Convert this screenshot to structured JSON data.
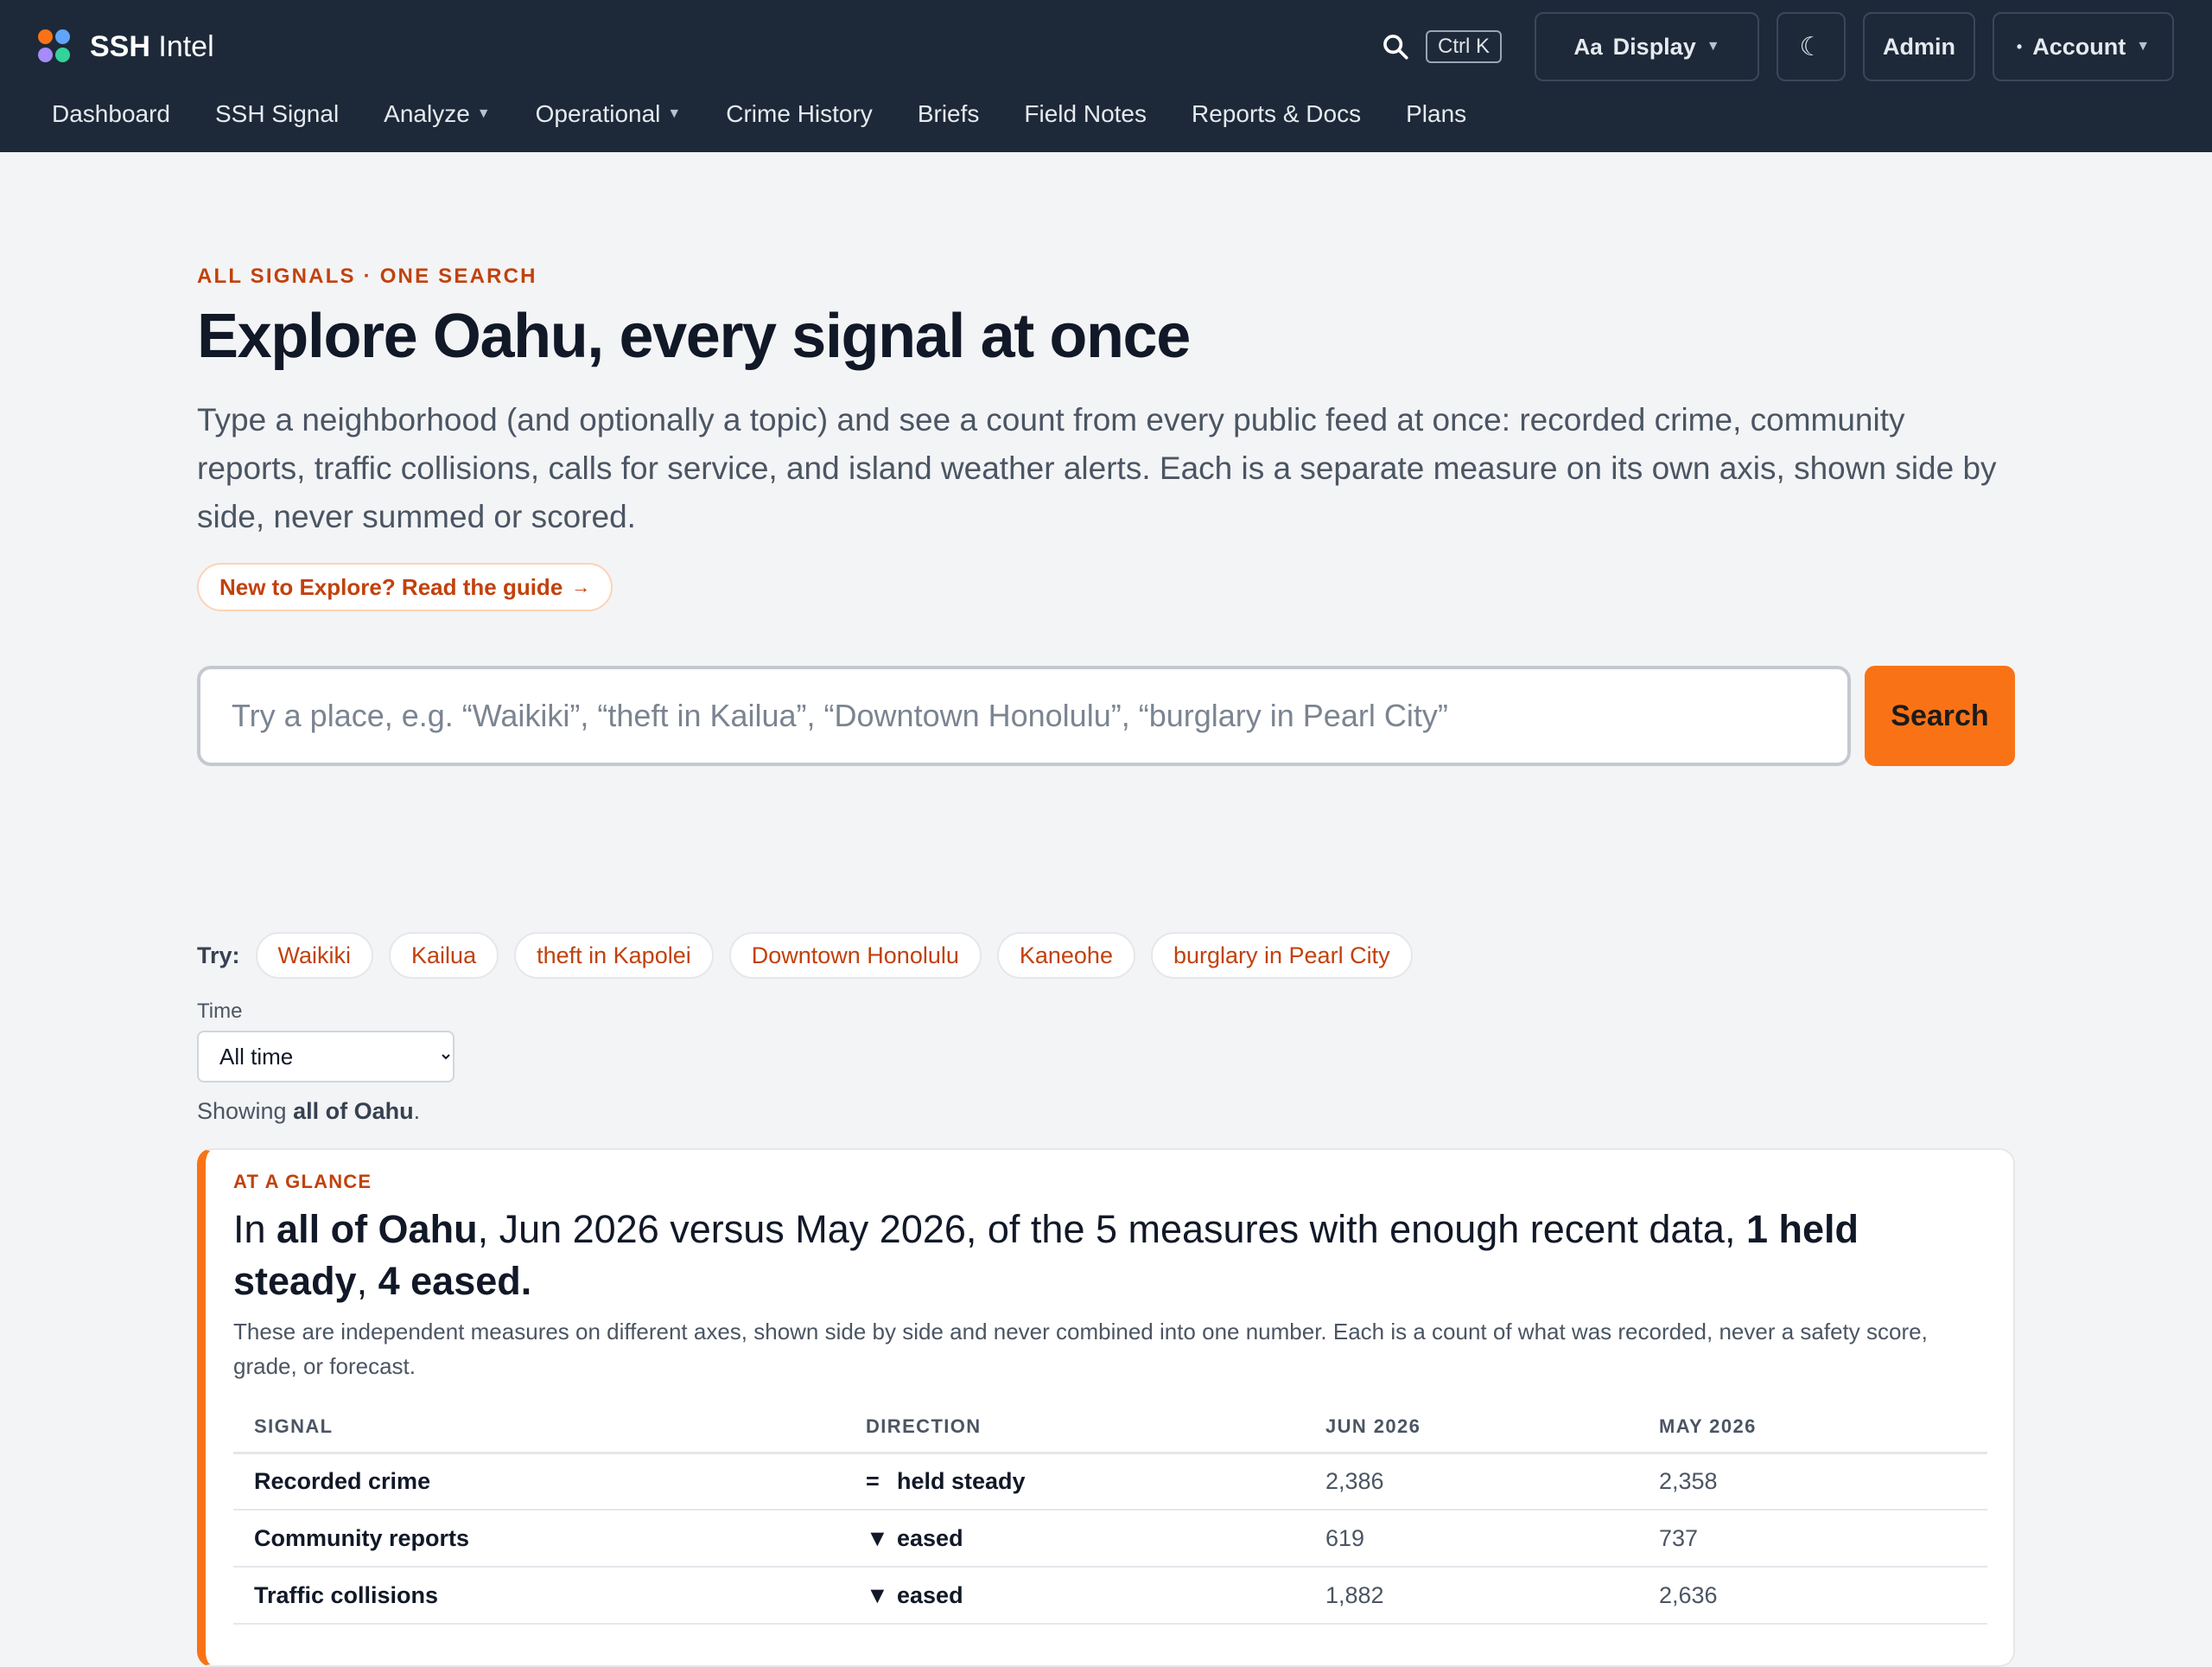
{
  "brand": {
    "name_bold": "SSH",
    "name_rest": "Intel"
  },
  "header": {
    "shortcut": "Ctrl K",
    "display_label": "Display",
    "display_icon_text": "Aa",
    "theme_icon": "moon-icon",
    "admin_label": "Admin",
    "account_label": "Account"
  },
  "nav": {
    "items": [
      {
        "label": "Dashboard"
      },
      {
        "label": "SSH Signal"
      },
      {
        "label": "Analyze",
        "dropdown": true
      },
      {
        "label": "Operational",
        "dropdown": true
      },
      {
        "label": "Crime History"
      },
      {
        "label": "Briefs"
      },
      {
        "label": "Field Notes"
      },
      {
        "label": "Reports & Docs"
      },
      {
        "label": "Plans"
      }
    ]
  },
  "hero": {
    "eyebrow": "ALL SIGNALS · ONE SEARCH",
    "title": "Explore Oahu, every signal at once",
    "lead": "Type a neighborhood (and optionally a topic) and see a count from every public feed at once: recorded crime, community reports, traffic collisions, calls for service, and island weather alerts. Each is a separate measure on its own axis, shown side by side, never summed or scored.",
    "guide_link": "New to Explore? Read the guide",
    "guide_arrow": "→"
  },
  "search": {
    "placeholder": "Try a place, e.g. “Waikiki”, “theft in Kailua”, “Downtown Honolulu”, “burglary in Pearl City”",
    "value": "",
    "button": "Search",
    "try_label": "Try:",
    "suggestions": [
      "Waikiki",
      "Kailua",
      "theft in Kapolei",
      "Downtown Honolulu",
      "Kaneohe",
      "burglary in Pearl City"
    ]
  },
  "filters": {
    "time_label": "Time",
    "time_selected": "All time",
    "showing_prefix": "Showing",
    "showing_area": "all of Oahu",
    "showing_suffix": "."
  },
  "glance": {
    "eyebrow": "AT A GLANCE",
    "title_parts": {
      "p1": "In ",
      "area": "all of Oahu",
      "p2": ", Jun 2026 versus May 2026, of the 5 measures with enough recent data, ",
      "steady": "1 held steady",
      "p3": ", ",
      "eased": "4 eased",
      "p4": "."
    },
    "note": "These are independent measures on different axes, shown side by side and never combined into one number. Each is a count of what was recorded, never a safety score, grade, or forecast.",
    "columns": [
      "SIGNAL",
      "DIRECTION",
      "JUN 2026",
      "MAY 2026"
    ],
    "rows": [
      {
        "signal": "Recorded crime",
        "symbol": "=",
        "direction": "held steady",
        "current": "2,386",
        "previous": "2,358"
      },
      {
        "signal": "Community reports",
        "symbol": "▼",
        "direction": "eased",
        "current": "619",
        "previous": "737"
      },
      {
        "signal": "Traffic collisions",
        "symbol": "▼",
        "direction": "eased",
        "current": "1,882",
        "previous": "2,636"
      }
    ]
  }
}
